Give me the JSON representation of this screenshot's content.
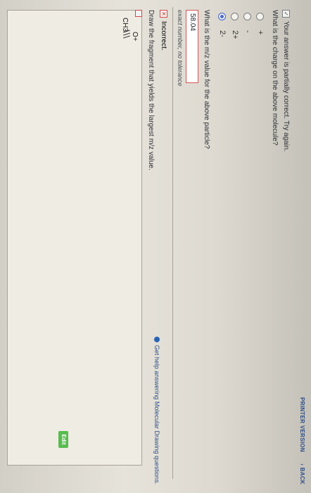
{
  "top_links": {
    "printer": "PRINTER VERSION",
    "back": "‹ BACK"
  },
  "feedback": "Your answer is partially correct. Try again.",
  "question_1": "What is the charge on the above molecule?",
  "answers": [
    "+",
    "-",
    "2+",
    "2-"
  ],
  "question_2": "What is the m/z value for the above particle?",
  "mz_value": "58.04",
  "hint": "exact number, no tolerance",
  "incorrect": "Incorrect.",
  "draw_prompt": "Draw the fragment that yields the largest m/z value.",
  "help_link": "Get help answering Molecular Drawing questions.",
  "edit_label": "Edit",
  "molecule": {
    "ch3": "CH3",
    "o_plus": "O+"
  }
}
